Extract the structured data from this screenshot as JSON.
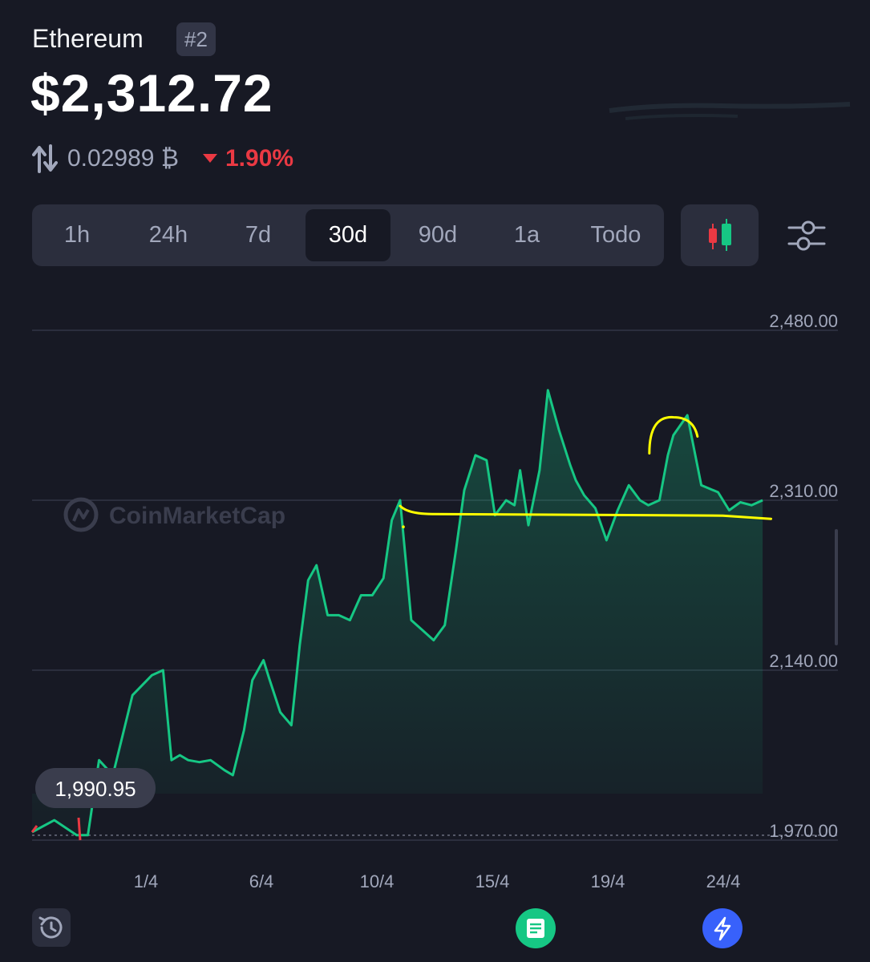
{
  "header": {
    "coin_name": "Ethereum",
    "rank": "#2",
    "price": "$2,312.72",
    "btc_value": "0.02989 ₿",
    "change_percent": "1.90%",
    "change_direction": "down",
    "change_color": "#ea3943"
  },
  "range_selector": {
    "options": [
      "1h",
      "24h",
      "7d",
      "30d",
      "90d",
      "1a",
      "Todo"
    ],
    "selected": "30d"
  },
  "toolbar": {
    "candle_icon": "candlestick-icon",
    "settings_icon": "sliders-icon"
  },
  "chart_data": {
    "type": "area",
    "watermark": "CoinMarketCap",
    "ylim": [
      1970,
      2480
    ],
    "y_ticks": [
      "2,480.00",
      "2,310.00",
      "2,140.00",
      "1,970.00"
    ],
    "x_ticks": [
      "1/4",
      "6/4",
      "10/4",
      "15/4",
      "19/4",
      "24/4"
    ],
    "start_price_label": "1,990.95",
    "line_color": "#16c784",
    "negative_color": "#ea3943",
    "grid": true,
    "series": [
      {
        "x": [
          0,
          0.8,
          1.6,
          2.0,
          2.4,
          2.9,
          3.6,
          4.3,
          4.7,
          5.0,
          5.3,
          5.6,
          6.0,
          6.4,
          6.9,
          7.2,
          7.6,
          7.9,
          8.3,
          8.5,
          8.9,
          9.3,
          9.6,
          9.9,
          10.2,
          10.6,
          11.0,
          11.4,
          11.8,
          12.2,
          12.6,
          12.9,
          13.2,
          13.4,
          13.6,
          14.0,
          14.4,
          14.8,
          15.2,
          15.5,
          15.9,
          16.3,
          16.6,
          17.0,
          17.3,
          17.5,
          17.8,
          18.2,
          18.5,
          18.9,
          19.3,
          19.5,
          19.8,
          20.2,
          20.6,
          21.0,
          21.4,
          21.8,
          22.1,
          22.5,
          22.8,
          23.0,
          23.5,
          24.0,
          24.6,
          25.0,
          25.4,
          25.8,
          26.2
        ],
        "values": [
          1978,
          1990,
          1975,
          1975,
          2050,
          2035,
          2115,
          2135,
          2140,
          2050,
          2055,
          2050,
          2048,
          2050,
          2040,
          2035,
          2080,
          2130,
          2150,
          2132,
          2098,
          2085,
          2165,
          2230,
          2245,
          2195,
          2195,
          2190,
          2215,
          2215,
          2232,
          2290,
          2310,
          2250,
          2190,
          2180,
          2170,
          2185,
          2260,
          2320,
          2355,
          2350,
          2295,
          2310,
          2305,
          2340,
          2285,
          2340,
          2420,
          2380,
          2345,
          2330,
          2315,
          2302,
          2270,
          2300,
          2325,
          2310,
          2305,
          2310,
          2355,
          2375,
          2395,
          2325,
          2318,
          2300,
          2308,
          2305,
          2310
        ]
      }
    ],
    "annotations": [
      {
        "type": "horizontal-line",
        "label": "support",
        "color": "#ffff00",
        "y": 2293,
        "x_start": 13.2,
        "x_end": 26.5
      },
      {
        "type": "arc",
        "label": "top",
        "color": "#ffff00",
        "x_center": 23.0,
        "y": 2385
      }
    ],
    "x_domain": [
      0,
      28.9
    ]
  },
  "bottom_bar": {
    "history_icon": "history-icon",
    "notes_icon": "notes-icon",
    "lightning_icon": "lightning-icon"
  }
}
